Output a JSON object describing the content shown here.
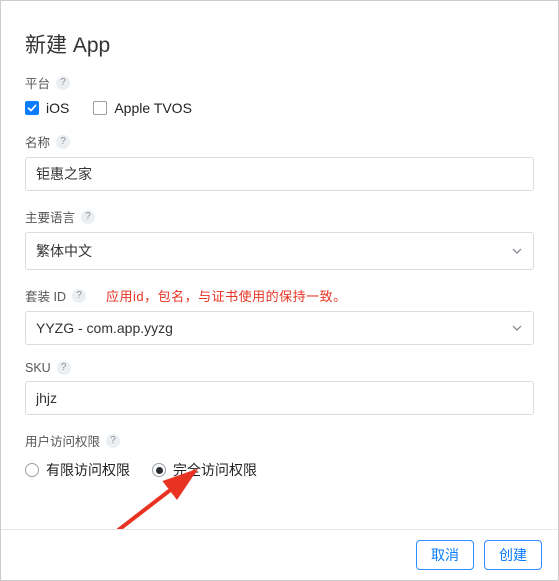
{
  "title": "新建 App",
  "platform": {
    "label": "平台",
    "ios": {
      "label": "iOS",
      "checked": true
    },
    "tvos": {
      "label": "Apple TVOS",
      "checked": false
    }
  },
  "name": {
    "label": "名称",
    "value": "钜惠之家"
  },
  "language": {
    "label": "主要语言",
    "value": "繁体中文"
  },
  "bundle": {
    "label": "套装 ID",
    "annotation": "应用id，包名，与证书使用的保持一致。",
    "value": "YYZG - com.app.yyzg"
  },
  "sku": {
    "label": "SKU",
    "value": "jhjz"
  },
  "access": {
    "label": "用户访问权限",
    "limited": "有限访问权限",
    "full": "完全访问权限",
    "selected": "full"
  },
  "footer": {
    "cancel": "取消",
    "create": "创建"
  }
}
